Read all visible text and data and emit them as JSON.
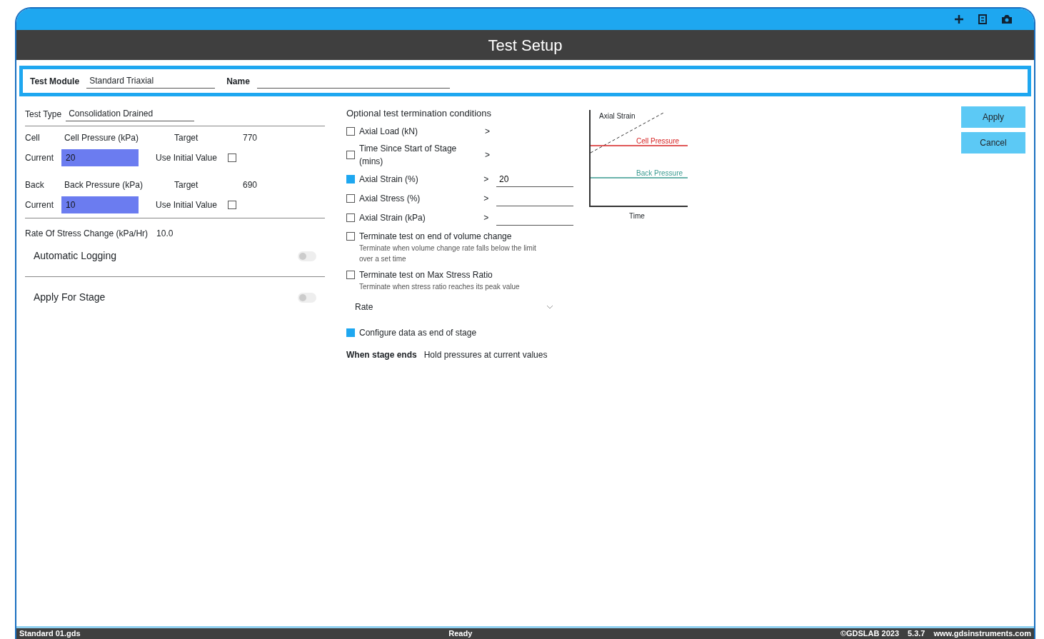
{
  "window": {
    "title": "Test Setup"
  },
  "module": {
    "label": "Test Module",
    "value": "Standard Triaxial",
    "name_label": "Name"
  },
  "test_type": {
    "label": "Test Type",
    "value": "Consolidation Drained"
  },
  "channels": [
    {
      "label": "Cell",
      "value": "Cell Pressure (kPa)",
      "target_label": "Target",
      "target": "770",
      "current_label": "Current",
      "current": "20",
      "initial_label": "Use Initial Value",
      "checked": false
    },
    {
      "label": "Back",
      "value": "Back Pressure (kPa)",
      "target_label": "Target",
      "target": "690",
      "current_label": "Current",
      "current": "10",
      "initial_label": "Use Initial Value",
      "checked": false
    }
  ],
  "rate": {
    "label": "Rate Of Stress Change (kPa/Hr)",
    "value": "10.0"
  },
  "toggles": [
    {
      "label": "Automatic Logging",
      "on": false
    },
    {
      "label": "Apply For Stage",
      "on": false
    }
  ],
  "termination": {
    "title": "Optional test termination conditions",
    "conditions": [
      {
        "kind": "compare",
        "label": "Axial Load (kN)",
        "operator": ">",
        "checked": false
      },
      {
        "kind": "compare",
        "label": "Time Since Start of Stage (mins)",
        "operator": ">",
        "checked": false
      },
      {
        "kind": "input",
        "label": "Axial Strain (%)",
        "operator": ">",
        "checked": true,
        "value": "20"
      },
      {
        "kind": "input",
        "label": "Axial Stress (%)",
        "operator": ">",
        "checked": false
      },
      {
        "kind": "input",
        "label": "Axial Strain (kPa)",
        "operator": ">",
        "checked": false
      },
      {
        "kind": "note",
        "label": "Terminate test on end of volume change",
        "checked": false,
        "value": "Terminate when volume change rate falls below the limit over a set time"
      },
      {
        "kind": "note",
        "label": "Terminate test on Max Stress Ratio",
        "checked": false,
        "value": "Terminate when stress ratio reaches its peak value"
      }
    ],
    "dropdown": "Rate"
  },
  "end_stage": {
    "label": "Configure data as end of stage",
    "checked": true
  },
  "when_ends": {
    "label": "When stage ends",
    "value": "Hold pressures at current values"
  },
  "chart": {
    "ylabel": "Axial Strain",
    "series": [
      {
        "name": "Cell Pressure",
        "color": "#d62020"
      },
      {
        "name": "Back Pressure",
        "color": "#3a9a90"
      }
    ],
    "xlabel": "Time"
  },
  "buttons": [
    {
      "label": "Apply"
    },
    {
      "label": "Cancel"
    }
  ],
  "status_bar": {
    "file": "Standard 01.gds",
    "status": "Ready",
    "copyright": "©GDSLAB 2023",
    "version": "5.3.7",
    "website": "www.gdsinstruments.com"
  }
}
